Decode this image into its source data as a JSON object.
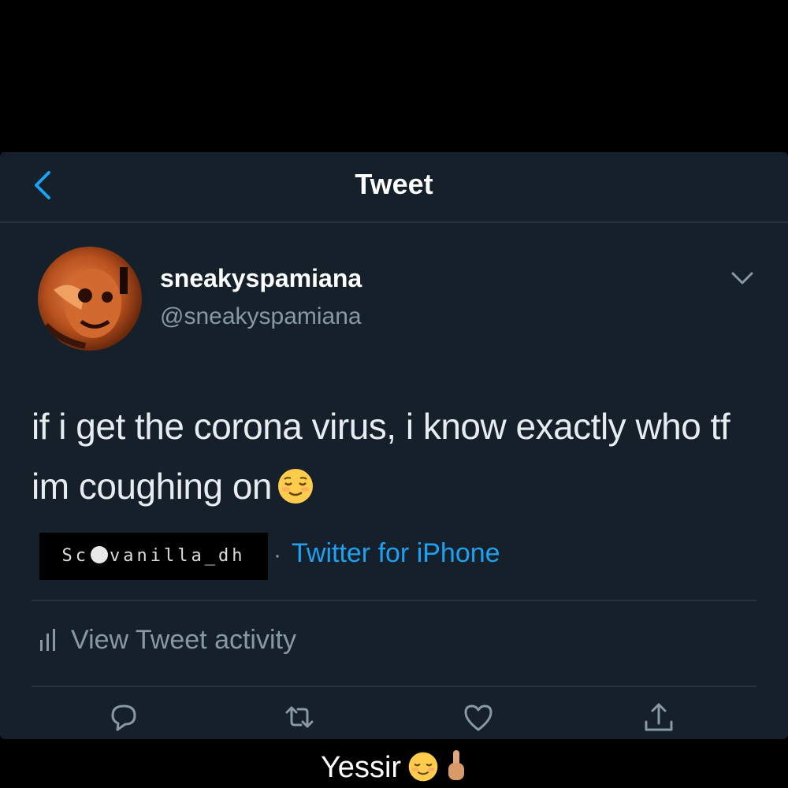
{
  "nav": {
    "title": "Tweet",
    "back_icon": "chevron-left-icon"
  },
  "author": {
    "display_name": "sneakyspamiana",
    "handle": "@sneakyspamiana"
  },
  "tweet": {
    "text": "if i get the corona virus, i know exactly who tf im coughing on",
    "emoji": "relieved-face-emoji"
  },
  "overlay": {
    "snapchat_prefix": "Sc",
    "snapchat_user": "vanilla_dh"
  },
  "meta": {
    "separator": "·",
    "source": "Twitter for iPhone"
  },
  "activity": {
    "label": "View Tweet activity",
    "icon": "bar-chart-icon"
  },
  "actions": {
    "reply": "reply-icon",
    "retweet": "retweet-icon",
    "like": "heart-icon",
    "share": "share-icon"
  },
  "caption": {
    "text": "Yessir"
  },
  "colors": {
    "background": "#15202b",
    "accent": "#1da1f2",
    "secondary_text": "#8899a6",
    "divider": "#253341"
  }
}
